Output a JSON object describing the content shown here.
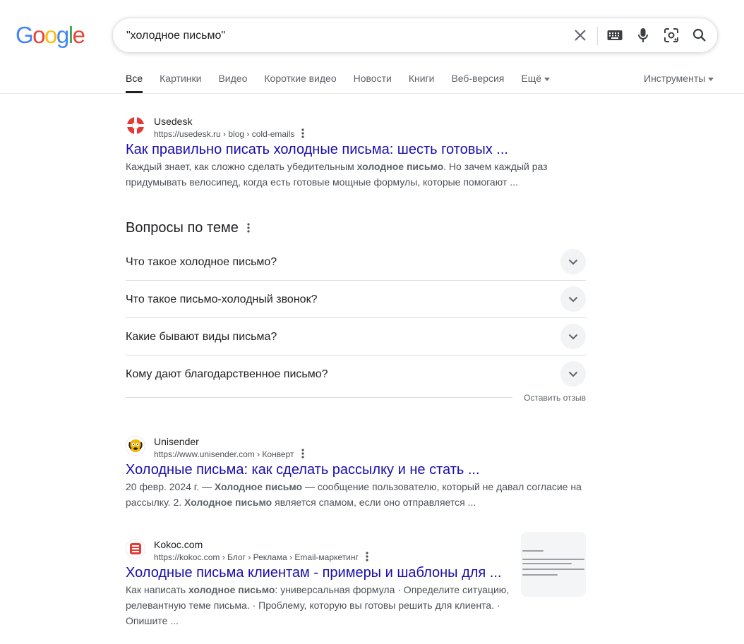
{
  "logo": {
    "text": "Google",
    "letters": [
      "G",
      "o",
      "o",
      "g",
      "l",
      "e"
    ]
  },
  "search": {
    "value": "\"холодное письмо\"",
    "placeholder": ""
  },
  "tabs": [
    {
      "label": "Все",
      "active": true
    },
    {
      "label": "Картинки"
    },
    {
      "label": "Видео"
    },
    {
      "label": "Короткие видео"
    },
    {
      "label": "Новости"
    },
    {
      "label": "Книги"
    },
    {
      "label": "Веб-версия"
    },
    {
      "label": "Ещё"
    }
  ],
  "tools_label": "Инструменты",
  "results": [
    {
      "site_name": "Usedesk",
      "url": "https://usedesk.ru › blog › cold-emails",
      "title": "Как правильно писать холодные письма: шесть готовых ...",
      "snippet_parts": [
        "Каждый знает, как сложно сделать убедительным ",
        "холодное письмо",
        ". Но зачем каждый раз придумывать велосипед, когда есть готовые мощные формулы, которые помогают ..."
      ]
    },
    {
      "site_name": "Unisender",
      "url": "https://www.unisender.com › Конверт",
      "title": "Холодные письма: как сделать рассылку и не стать ...",
      "snippet_parts": [
        "20 февр. 2024 г. — ",
        "Холодное письмо",
        " — сообщение пользователю, который не давал согласие на рассылку. 2. ",
        "Холодное письмо",
        " является спамом, если оно отправляется ..."
      ]
    },
    {
      "site_name": "Kokoc.com",
      "url": "https://kokoc.com › Блог › Реклама › Email-маркетинг",
      "title": "Холодные письма клиентам - примеры и шаблоны для ...",
      "snippet_parts": [
        "Как написать ",
        "холодное письмо",
        ": универсальная формула · Определите ситуацию, релевантную теме письма. · Проблему, которую вы готовы решить для клиента. · Опишите ..."
      ]
    }
  ],
  "paa": {
    "heading": "Вопросы по теме",
    "questions": [
      "Что такое холодное письмо?",
      "Что такое письмо-холодный звонок?",
      "Какие бывают виды письма?",
      "Кому дают благодарственное письмо?"
    ],
    "feedback": "Оставить отзыв"
  },
  "icons": {
    "clear": "close-icon",
    "keyboard": "keyboard-icon",
    "voice": "microphone-icon",
    "lens": "camera-lens-icon",
    "search": "search-icon",
    "more": "more-vert-icon",
    "expand": "chevron-down-icon"
  },
  "colors": {
    "link": "#1a0dab",
    "text": "#202124",
    "muted": "#4d5156",
    "google_blue": "#4285f4",
    "google_red": "#ea4335",
    "google_yellow": "#fbbc05",
    "google_green": "#34a853"
  }
}
